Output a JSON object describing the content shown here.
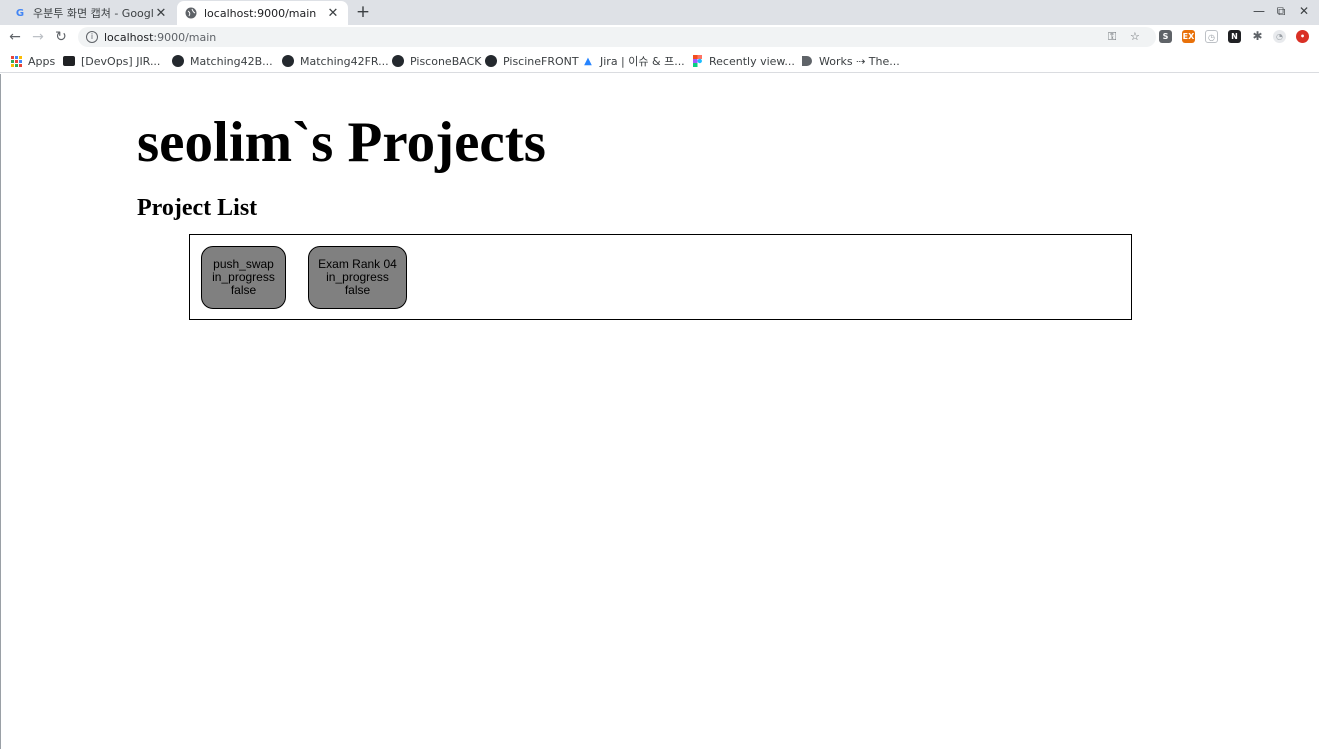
{
  "browser": {
    "tabs": [
      {
        "title": "우분투 화면 캡쳐 - Google 검색",
        "favicon": "google-icon",
        "active": false
      },
      {
        "title": "localhost:9000/main",
        "favicon": "globe-icon",
        "active": true
      }
    ],
    "address": {
      "host": "localhost",
      "path": ":9000/main"
    },
    "bookmarks": [
      {
        "label": "Apps",
        "icon": "apps-grid-icon"
      },
      {
        "label": "[DevOps] JIR...",
        "icon": "devops-icon"
      },
      {
        "label": "Matching42B...",
        "icon": "github-icon"
      },
      {
        "label": "Matching42FR...",
        "icon": "github-icon"
      },
      {
        "label": "PisconeBACK",
        "icon": "github-icon"
      },
      {
        "label": "PiscineFRONT",
        "icon": "github-icon"
      },
      {
        "label": "Jira | 이슈 & 프...",
        "icon": "jira-icon"
      },
      {
        "label": "Recently view...",
        "icon": "figma-icon"
      },
      {
        "label": "Works ⇢ The...",
        "icon": "works-icon"
      }
    ]
  },
  "page": {
    "title": "seolim`s Projects",
    "section_title": "Project List",
    "projects": [
      {
        "name": "push_swap",
        "status": "in_progress",
        "flag": "false"
      },
      {
        "name": "Exam Rank 04",
        "status": "in_progress",
        "flag": "false"
      }
    ]
  }
}
